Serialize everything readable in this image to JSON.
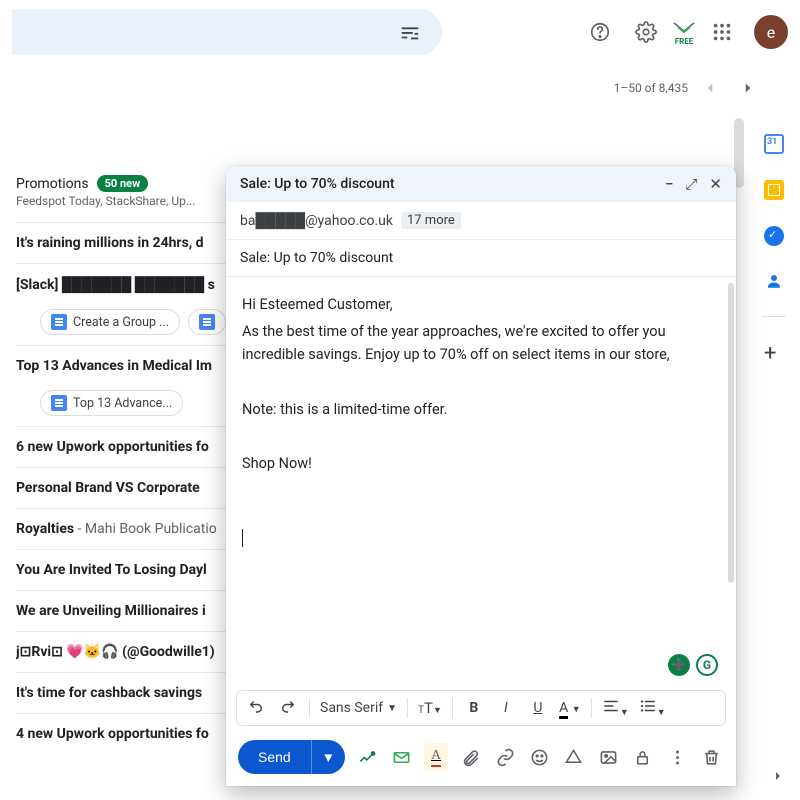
{
  "topbar": {
    "avatar_letter": "e",
    "free_label": "FREE"
  },
  "pager": {
    "range": "1–50 of 8,435"
  },
  "promotions": {
    "title": "Promotions",
    "badge": "50 new",
    "subtitle": "Feedspot Today, StackShare, Up..."
  },
  "emails": [
    {
      "subject": "It's raining millions in 24hrs, d"
    },
    {
      "subject": "[Slack] ███████ ███████ s",
      "chips": [
        "Create a Group ...",
        ""
      ]
    },
    {
      "subject": "Top 13 Advances in Medical Im",
      "chips": [
        "Top 13 Advance..."
      ]
    },
    {
      "subject": "6 new Upwork opportunities fo"
    },
    {
      "subject": "Personal Brand VS Corporate "
    },
    {
      "subject": "Royalties",
      "light": " - Mahi Book Publicatio"
    },
    {
      "subject": "You Are Invited To Losing Dayl"
    },
    {
      "subject": "We are Unveiling Millionaires i"
    },
    {
      "subject": "j⊡Rvi⊡ 💗🐱🎧 (@Goodwille1)"
    },
    {
      "subject": "It's time for cashback savings"
    },
    {
      "subject": "4 new Upwork opportunities fo"
    }
  ],
  "compose": {
    "title": "Sale: Up to 70% discount",
    "to": "ba█████@yahoo.co.uk",
    "more": "17 more",
    "subject": "Sale: Up to 70% discount",
    "body_lines": [
      "Hi Esteemed Customer,",
      "As the best time of the year approaches, we're excited to offer you incredible savings. Enjoy up to 70% off on select items in our store,",
      "",
      "Note: this is a limited-time offer.",
      "",
      "Shop Now!"
    ],
    "font": "Sans Serif",
    "send_label": "Send"
  }
}
